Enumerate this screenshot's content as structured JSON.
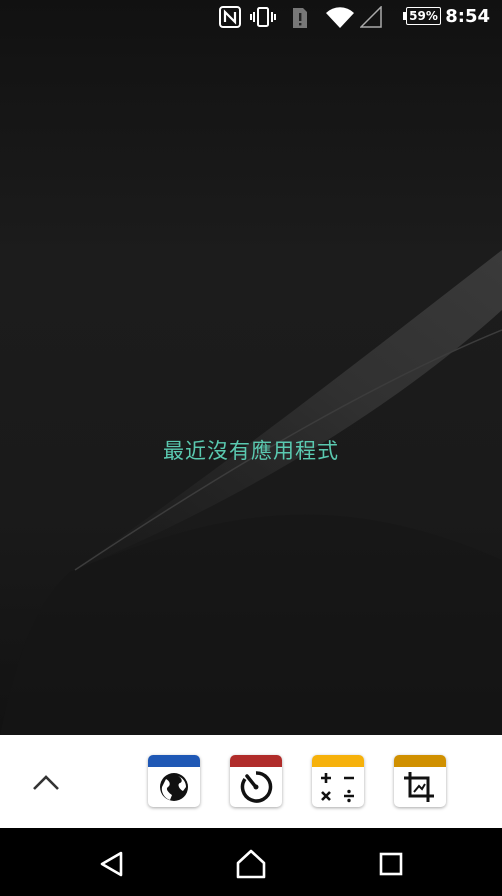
{
  "status_bar": {
    "time": "8:54",
    "battery_percent": "59%",
    "icons": [
      "nfc-icon",
      "vibrate-icon",
      "sim-alert-icon",
      "wifi-icon",
      "cell-signal-icon",
      "battery-icon"
    ]
  },
  "recents": {
    "empty_message": "最近沒有應用程式"
  },
  "quick_apps": {
    "apps": [
      {
        "name": "globe-app",
        "band_color": "#1f58b5"
      },
      {
        "name": "timer-app",
        "band_color": "#b02c2a"
      },
      {
        "name": "calculator-app",
        "band_color": "#f6b10b"
      },
      {
        "name": "screenshot-crop-app",
        "band_color": "#d09000"
      }
    ]
  },
  "navigation": {
    "buttons": [
      "back-button",
      "home-button",
      "recents-button"
    ]
  },
  "colors": {
    "accent_text": "#5ac9b0",
    "panel_bg": "#ffffff",
    "nav_bg": "#000000"
  }
}
